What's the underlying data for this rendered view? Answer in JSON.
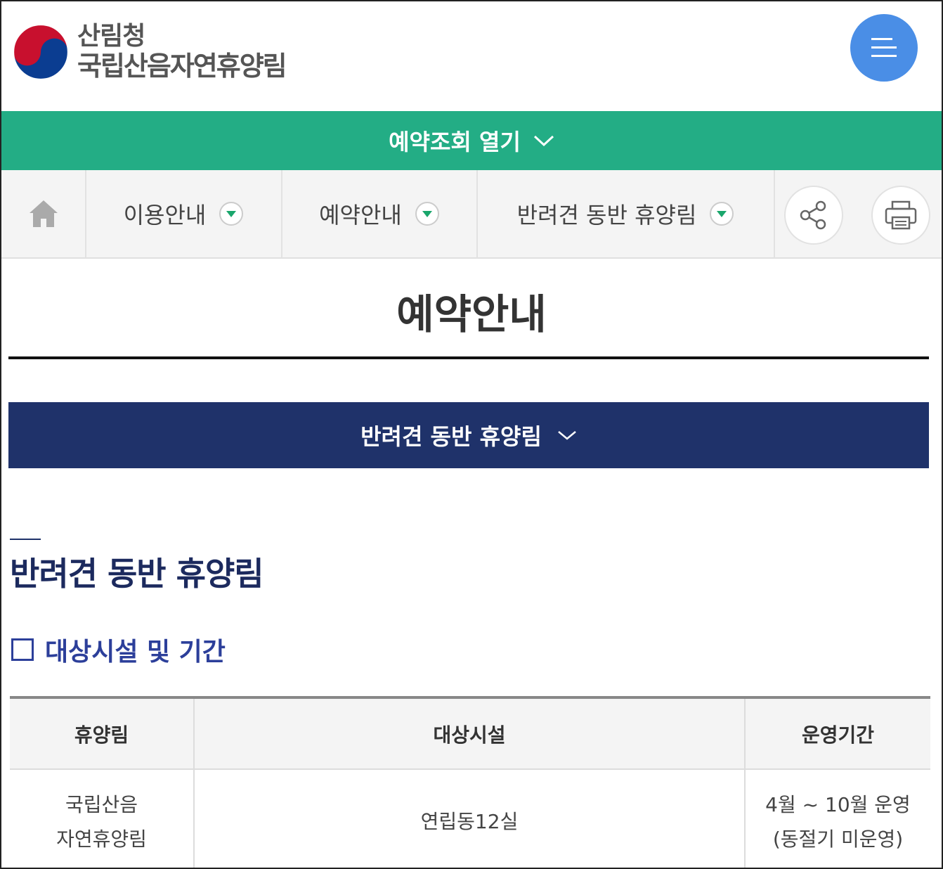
{
  "header": {
    "org_name": "산림청",
    "site_name": "국립산음자연휴양림",
    "menu_icon": "hamburger-menu-icon"
  },
  "reserve_bar": {
    "label": "예약조회 열기"
  },
  "nav": {
    "home_icon": "home-icon",
    "items": [
      {
        "label": "이용안내"
      },
      {
        "label": "예약안내"
      },
      {
        "label": "반려견 동반 휴양림"
      }
    ],
    "share_icon": "share-icon",
    "print_icon": "print-icon"
  },
  "page_title": "예약안내",
  "section_select": {
    "label": "반려견 동반 휴양림"
  },
  "section_heading": "반려견 동반 휴양림",
  "sub_heading": "대상시설 및 기간",
  "table": {
    "headers": [
      "휴양림",
      "대상시설",
      "운영기간"
    ],
    "rows": [
      {
        "forest_line1": "국립산음",
        "forest_line2": "자연휴양림",
        "facility": "연립동12실",
        "period_line1": "4월 ~ 10월 운영",
        "period_line2": "(동절기 미운영)"
      }
    ]
  },
  "colors": {
    "green_bar": "#23ad85",
    "navy_bar": "#1f326a",
    "menu_blue": "#4a8ee6",
    "heading_navy": "#1c2a5e"
  }
}
